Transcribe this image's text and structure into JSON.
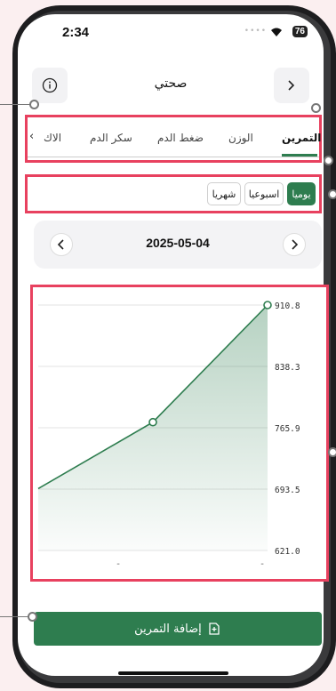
{
  "status": {
    "time": "2:34",
    "battery": "76"
  },
  "header": {
    "title": "صحتي",
    "info_icon": "info-icon",
    "forward_icon": "chevron-right-icon"
  },
  "tabs": {
    "items": [
      {
        "label": "التمرين",
        "active": true
      },
      {
        "label": "الوزن",
        "active": false
      },
      {
        "label": "ضغط الدم",
        "active": false
      },
      {
        "label": "سكر الدم",
        "active": false
      },
      {
        "label": "الاك",
        "active": false
      }
    ],
    "scroll_icon": "chevron-left-icon"
  },
  "periods": [
    {
      "label": "يوميا",
      "active": true
    },
    {
      "label": "اسبوعيا",
      "active": false
    },
    {
      "label": "شهريا",
      "active": false
    }
  ],
  "date_nav": {
    "date": "2025-05-04",
    "prev_icon": "chevron-left-icon",
    "next_icon": "chevron-right-icon"
  },
  "chart_data": {
    "type": "area",
    "y_ticks": [
      "910.8",
      "838.3",
      "765.9",
      "693.5",
      "621.0"
    ],
    "ylim": [
      621.0,
      910.8
    ],
    "x_ticks": [
      "-",
      "-"
    ],
    "points": [
      {
        "x": 0,
        "y": 694.0
      },
      {
        "x": 1,
        "y": 772.5
      },
      {
        "x": 2,
        "y": 910.8
      }
    ],
    "line_color": "#2e7d4f",
    "fill_color": "#2e7d4f",
    "grid": true
  },
  "add_button": {
    "label": "إضافة التمرين",
    "icon": "add-note-icon"
  },
  "colors": {
    "accent": "#2e7d4f",
    "highlight": "#e8415f"
  }
}
